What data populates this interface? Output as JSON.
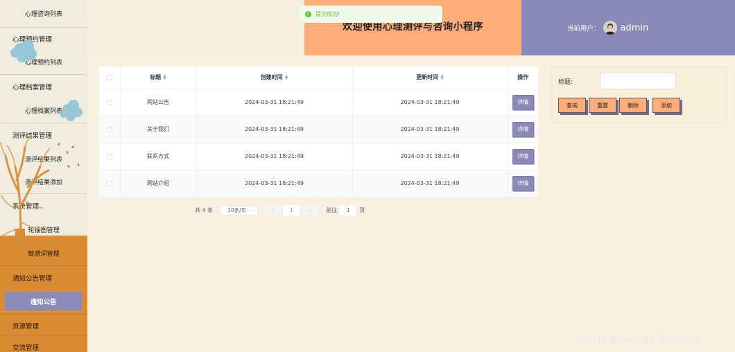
{
  "header": {
    "title": "欢迎使用心理测评与咨询小程序",
    "user_label": "当前用户：",
    "user_name": "admin"
  },
  "toast": {
    "message": "提交成功!"
  },
  "sidebar": {
    "items": [
      {
        "label": "心理咨询列表"
      },
      {
        "label": "心理预约管理"
      },
      {
        "label": "心理预约列表"
      },
      {
        "label": "心理档案管理"
      },
      {
        "label": "心理档案列表"
      },
      {
        "label": "测评结果管理"
      },
      {
        "label": "测评结果列表"
      },
      {
        "label": "测评结果添加"
      },
      {
        "label": "系统管理"
      },
      {
        "label": "轮播图管理"
      },
      {
        "label": "敏感词管理"
      },
      {
        "label": "通知公告管理"
      },
      {
        "label": "通知公告"
      },
      {
        "label": "资源管理"
      },
      {
        "label": "交流管理"
      }
    ]
  },
  "table": {
    "headers": {
      "title": "标题",
      "created": "创建时间",
      "updated": "更新时间",
      "action": "操作"
    },
    "detail_label": "详情",
    "rows": [
      {
        "title": "网站公告",
        "created": "2024-03-31 18:21:49",
        "updated": "2024-03-31 18:21:49"
      },
      {
        "title": "关于我们",
        "created": "2024-03-31 18:21:49",
        "updated": "2024-03-31 18:21:49"
      },
      {
        "title": "联系方式",
        "created": "2024-03-31 18:21:49",
        "updated": "2024-03-31 18:21:49"
      },
      {
        "title": "网站介绍",
        "created": "2024-03-31 18:21:49",
        "updated": "2024-03-31 18:21:49"
      }
    ]
  },
  "pagination": {
    "total": "共 4 条",
    "page_size": "10条/页",
    "current_page": "1",
    "goto_label": "前往",
    "goto_value": "1",
    "page_unit": "页"
  },
  "search": {
    "title_label": "标题:",
    "title_value": "",
    "buttons": {
      "query": "查询",
      "reset": "重置",
      "delete": "删除",
      "add": "添加"
    }
  },
  "watermark": "CSDN @weixin_ZYKJ985",
  "colors": {
    "accent": "#8a89b8",
    "peach": "#fdac7a",
    "orange": "#d98c34",
    "success": "#67c23a"
  }
}
